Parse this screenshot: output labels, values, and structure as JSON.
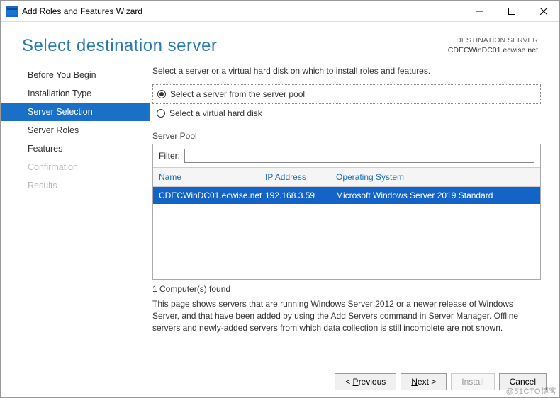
{
  "window": {
    "title": "Add Roles and Features Wizard"
  },
  "header": {
    "page_title": "Select destination server",
    "dest_label": "DESTINATION SERVER",
    "dest_value": "CDECWinDC01.ecwise.net"
  },
  "nav": [
    {
      "label": "Before You Begin",
      "state": "enabled"
    },
    {
      "label": "Installation Type",
      "state": "enabled"
    },
    {
      "label": "Server Selection",
      "state": "selected"
    },
    {
      "label": "Server Roles",
      "state": "enabled"
    },
    {
      "label": "Features",
      "state": "enabled"
    },
    {
      "label": "Confirmation",
      "state": "disabled"
    },
    {
      "label": "Results",
      "state": "disabled"
    }
  ],
  "content": {
    "instruction": "Select a server or a virtual hard disk on which to install roles and features.",
    "radio1": "Select a server from the server pool",
    "radio2": "Select a virtual hard disk",
    "pool_label": "Server Pool",
    "filter_label": "Filter:",
    "filter_value": "",
    "columns": {
      "name": "Name",
      "ip": "IP Address",
      "os": "Operating System"
    },
    "rows": [
      {
        "name": "CDECWinDC01.ecwise.net",
        "ip": "192.168.3.59",
        "os": "Microsoft Windows Server 2019 Standard"
      }
    ],
    "count": "1 Computer(s) found",
    "footnote": "This page shows servers that are running Windows Server 2012 or a newer release of Windows Server, and that have been added by using the Add Servers command in Server Manager. Offline servers and newly-added servers from which data collection is still incomplete are not shown."
  },
  "buttons": {
    "previous": "Previous",
    "next": "Next >",
    "install": "Install",
    "cancel": "Cancel"
  },
  "watermark": "@51CTO博客"
}
